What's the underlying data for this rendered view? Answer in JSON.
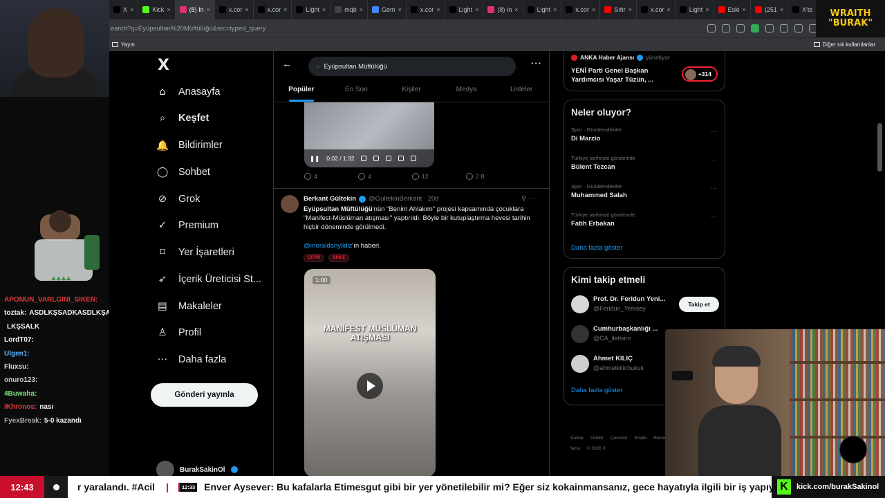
{
  "browser": {
    "tabs": [
      {
        "label": "X",
        "color": "#000000"
      },
      {
        "label": "Kick",
        "color": "#53fc18"
      },
      {
        "label": "(8) In",
        "color": "#e1306c"
      },
      {
        "label": "x.cor",
        "color": "#000000"
      },
      {
        "label": "x.cor",
        "color": "#000000"
      },
      {
        "label": "Light",
        "color": "#000000"
      },
      {
        "label": "mqb",
        "color": "#444444"
      },
      {
        "label": "Gem",
        "color": "#4285f4"
      },
      {
        "label": "x.cor",
        "color": "#000000"
      },
      {
        "label": "Light",
        "color": "#000000"
      },
      {
        "label": "(8) In",
        "color": "#e1306c"
      },
      {
        "label": "Light",
        "color": "#000000"
      },
      {
        "label": "x.cor",
        "color": "#000000"
      },
      {
        "label": "Sıfır",
        "color": "#ff0000"
      },
      {
        "label": "x.cor",
        "color": "#000000"
      },
      {
        "label": "Light",
        "color": "#000000"
      },
      {
        "label": "Eski",
        "color": "#ff0000"
      },
      {
        "label": "(251",
        "color": "#ff0000"
      },
      {
        "label": "X'te",
        "color": "#000000"
      },
      {
        "label": "(8) In",
        "color": "#e1306c"
      }
    ],
    "new_tab": "+",
    "url": "earch?q=Eyüpsultan%20Müftülüğü&src=typed_query",
    "bookmark": "Yayın",
    "bookmarks_right": "Diğer sık kullanılanlar"
  },
  "brand": {
    "line1": "WRAITH",
    "line2": "\"BURAK\""
  },
  "chat": [
    {
      "user": "APONUN_VARLGINI_SIKEN:",
      "text": ""
    },
    {
      "user": "toztak:",
      "text": "ASDLKŞSADKASDLKŞAS"
    },
    {
      "user": "",
      "text": "LKŞSALK"
    },
    {
      "user": "LordT07:",
      "text": ""
    },
    {
      "user": "Ulgen1:",
      "text": ""
    },
    {
      "user": "Fluxsu:",
      "text": ""
    },
    {
      "user": "onuro123:",
      "text": ""
    },
    {
      "user": "4Buwaha:",
      "text": ""
    },
    {
      "user": "iKhronos:",
      "text": "nası"
    },
    {
      "user": "FyexBreak:",
      "text": "5-0 kazandı"
    }
  ],
  "nav": {
    "logo": "X",
    "items": [
      {
        "label": "Anasayfa",
        "icon": "home-icon"
      },
      {
        "label": "Keşfet",
        "icon": "search-icon",
        "bold": true
      },
      {
        "label": "Bildirimler",
        "icon": "bell-icon"
      },
      {
        "label": "Sohbet",
        "icon": "chat-icon"
      },
      {
        "label": "Grok",
        "icon": "grok-icon"
      },
      {
        "label": "Premium",
        "icon": "premium-icon"
      },
      {
        "label": "Yer İşaretleri",
        "icon": "bookmark-icon"
      },
      {
        "label": "İçerik Üreticisi St...",
        "icon": "rocket-icon"
      },
      {
        "label": "Makaleler",
        "icon": "article-icon"
      },
      {
        "label": "Profil",
        "icon": "person-icon"
      },
      {
        "label": "Daha fazla",
        "icon": "more-icon"
      }
    ],
    "post_button": "Gönderi yayınla",
    "account": "BurakSakinOl"
  },
  "feed": {
    "search_value": "Eyüpsultan Müftülüğü",
    "tabs": [
      "Popüler",
      "En Son",
      "Kişiler",
      "Medya",
      "Listeler"
    ],
    "video1": {
      "time": "0:02 / 1:32"
    },
    "actions1": {
      "replies": "4",
      "reposts": "4",
      "likes": "12",
      "views": "2 B"
    },
    "tweet2": {
      "name": "Berkant Gültekin",
      "handle": "@GultekinBerkant · 20d",
      "body_bold": "Eyüpsultan Müftülüğü",
      "body": "'nün \"Benim Ahlakım\" projesi kapsamında çocuklara \"Manifest-Müslüman atışması\" yaptırıldı. Böyle bir kutuplaştırma hevesi tarihin hiçbir döneminde görülmedi.",
      "mention": "@meraldanyildiz",
      "mention_suffix": "'ın haberi.",
      "pills": [
        "ÇEVİR",
        "DİNLE"
      ],
      "video_time": "1:00",
      "video_caption": "MANİFEST MÜSLÜMAN ATIŞMASI"
    }
  },
  "sidebar": {
    "anka": {
      "source": "ANKA Haber Ajansı",
      "role": "yönetiyor",
      "text": "YENİ Parti Genel Başkan Yardımcısı Yaşar Tüzün, ...",
      "count": "+314"
    },
    "trends_title": "Neler oluyor?",
    "trends": [
      {
        "context": "Spor · Gündemdekiler",
        "title": "Di Marzio"
      },
      {
        "context": "Türkiye tarihinde gündemde",
        "title": "Bülent Tezcan"
      },
      {
        "context": "Spor · Gündemdekiler",
        "title": "Muhammed Salah"
      },
      {
        "context": "Türkiye tarihinde gündemde",
        "title": "Fatih Erbakan"
      }
    ],
    "show_more": "Daha fazla göster",
    "follow_title": "Kimi takip etmeli",
    "follow": [
      {
        "name": "Prof. Dr. Feridun Yeni...",
        "handle": "@Feridun_Yenisey",
        "button": "Takip et"
      },
      {
        "name": "Cumhurbaşkanlığı ...",
        "handle": "@CA_iletisim",
        "button": ""
      },
      {
        "name": "Ahmet KILIÇ",
        "handle": "@ahmetkilichukuk",
        "button": ""
      }
    ],
    "follow_more": "Daha fazla göster",
    "footer": [
      "Şartlar",
      "Gizlilik",
      "Çerezler",
      "Erişile",
      "Reklam Bilgileri",
      "Daha fazla",
      "© 2026 X"
    ]
  },
  "ticker": {
    "clock": "12:43",
    "text1": "r yaralandı. #Acil",
    "time2": "12:33",
    "text2": "Enver Aysever: Bu kafalarla Etimesgut gibi bir yer yönetilebilir mi? Eğer siz kokainmansanız, gece hayatıyla ilgili bir iş yapıyor ve",
    "kick_logo": "K",
    "kick_url": "kick.com/burakSakinol"
  },
  "colors": {
    "accent": "#1d9bf0",
    "ticker_red": "#c8102e",
    "kick": "#53fc18"
  }
}
